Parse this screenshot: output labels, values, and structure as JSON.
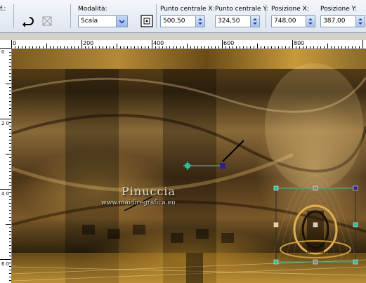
{
  "toolbar": {
    "left_label": "f.:",
    "mode_label": "Modalità:",
    "mode_value": "Scala",
    "center_x_label": "Punto centrale X:",
    "center_x_value": "500,50",
    "center_y_label": "Punto centrale Y:",
    "center_y_value": "324,50",
    "pos_x_label": "Posizione X:",
    "pos_x_value": "748,00",
    "pos_y_label": "Posizione Y:",
    "pos_y_value": "387,00"
  },
  "ruler": {
    "h_ticks": [
      "0",
      "200",
      "400",
      "600",
      "800"
    ],
    "v_ticks": [
      "0",
      "2 0 0",
      "4 0 0",
      "6 0"
    ]
  },
  "canvas": {
    "watermark_name": "Pinuccia",
    "watermark_url": "www.maidiregrafica.eu"
  },
  "colors": {
    "handle": "#2dbd9a",
    "pivot": "#2e1f9a",
    "frame": "#3a3a3a"
  }
}
